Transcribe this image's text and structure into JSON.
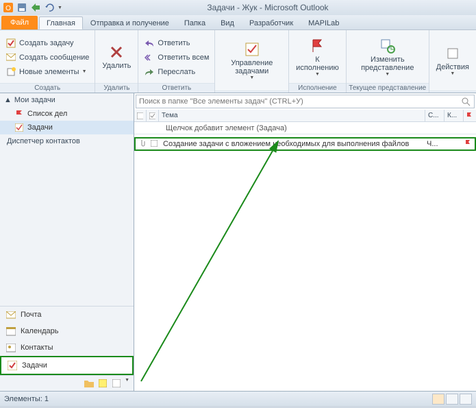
{
  "title": "Задачи - Жук - Microsoft Outlook",
  "tabs": {
    "file": "Файл",
    "home": "Главная",
    "sendreceive": "Отправка и получение",
    "folder": "Папка",
    "view": "Вид",
    "developer": "Разработчик",
    "mapilab": "MAPILab"
  },
  "ribbon": {
    "create": {
      "task": "Создать задачу",
      "message": "Создать сообщение",
      "newitems": "Новые элементы",
      "label": "Создать"
    },
    "delete": {
      "btn": "Удалить",
      "label": "Удалить"
    },
    "reply": {
      "reply": "Ответить",
      "replyall": "Ответить всем",
      "forward": "Переслать",
      "label": "Ответить"
    },
    "manage": {
      "tasks": "Управление задачами",
      "label": ""
    },
    "exec": {
      "btn": "К исполнению",
      "label": "Исполнение"
    },
    "view": {
      "btn": "Изменить представление",
      "label": "Текущее представление"
    },
    "actions": {
      "btn": "Действия",
      "label": ""
    }
  },
  "sidebar": {
    "header": "Мои задачи",
    "items": [
      "Список дел",
      "Задачи"
    ],
    "dispatcher": "Диспетчер контактов"
  },
  "nav": {
    "mail": "Почта",
    "calendar": "Календарь",
    "contacts": "Контакты",
    "tasks": "Задачи"
  },
  "search": {
    "placeholder": "Поиск в папке \"Все элементы задач\" (CTRL+У)"
  },
  "columns": {
    "subject": "Тема",
    "c": "С...",
    "k": "К..."
  },
  "newtask": "Щелчок добавит элемент (Задача)",
  "taskrow": {
    "subject": "Создание задачи с вложением необходимых для выполнения файлов",
    "due": "Ч..."
  },
  "status": {
    "items": "Элементы: 1"
  }
}
